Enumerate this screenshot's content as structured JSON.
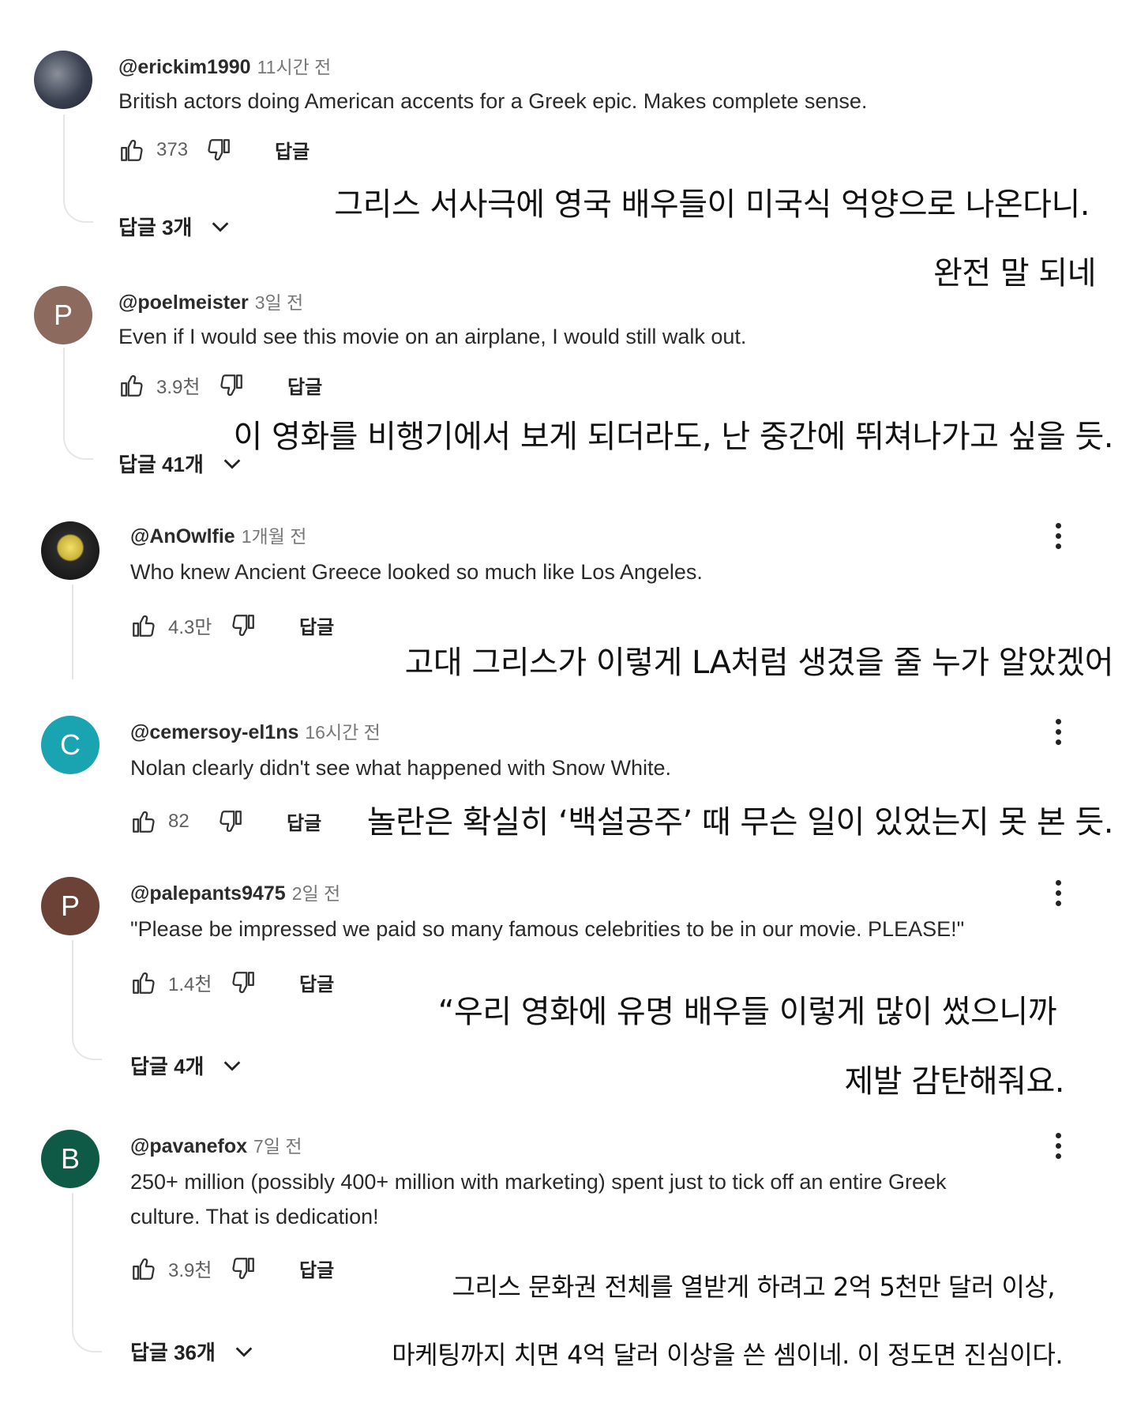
{
  "comments": [
    {
      "handle": "@erickim1990",
      "time": "11시간 전",
      "text": "British actors doing American accents for a Greek epic. Makes complete sense.",
      "likes": "373",
      "reply_label": "답글",
      "replies_label": "답글 3개",
      "translation": [
        "그리스 서사극에 영국 배우들이 미국식 억양으로 나온다니.",
        "완전 말 되네"
      ]
    },
    {
      "handle": "@poelmeister",
      "time": "3일 전",
      "avatar_letter": "P",
      "text": "Even if I would see this movie on an airplane, I would still walk out.",
      "likes": "3.9천",
      "reply_label": "답글",
      "replies_label": "답글 41개",
      "translation": [
        "이 영화를 비행기에서 보게 되더라도, 난 중간에 뛰쳐나가고 싶을 듯."
      ]
    },
    {
      "handle": "@AnOwlfie",
      "time": "1개월 전",
      "text": "Who knew Ancient Greece looked so much like Los Angeles.",
      "likes": "4.3만",
      "reply_label": "답글",
      "translation": [
        "고대 그리스가 이렇게 LA처럼 생겼을 줄 누가 알았겠어"
      ]
    },
    {
      "handle": "@cemersoy-el1ns",
      "time": "16시간 전",
      "avatar_letter": "C",
      "text": "Nolan clearly didn't see what happened with Snow White.",
      "likes": "82",
      "reply_label": "답글",
      "translation": [
        "놀란은 확실히 ‘백설공주’ 때 무슨 일이 있었는지 못 본 듯."
      ]
    },
    {
      "handle": "@palepants9475",
      "time": "2일 전",
      "avatar_letter": "P",
      "text": "\"Please be impressed we paid so many famous celebrities to be in our movie. PLEASE!\"",
      "likes": "1.4천",
      "reply_label": "답글",
      "replies_label": "답글 4개",
      "translation": [
        "“우리 영화에 유명 배우들 이렇게 많이 썼으니까",
        "제발 감탄해줘요."
      ]
    },
    {
      "handle": "@pavanefox",
      "time": "7일 전",
      "avatar_letter": "B",
      "text_line1": "250+ million (possibly 400+ million with marketing) spent just to tick off an entire Greek",
      "text_line2": "culture. That is dedication!",
      "likes": "3.9천",
      "reply_label": "답글",
      "replies_label": "답글 36개",
      "translation": [
        "그리스 문화권 전체를 열받게 하려고 2억 5천만 달러 이상,",
        "마케팅까지 치면 4억 달러 이상을 쓴 셈이네. 이 정도면 진심이다."
      ]
    }
  ],
  "colors": {
    "avatar_p1": "#8d6a5e",
    "avatar_c": "#1aa3b1",
    "avatar_p2": "#6d4236",
    "avatar_b": "#0f5a47"
  },
  "icons": [
    "like-icon",
    "dislike-icon",
    "chevron-down-icon",
    "more-vert-icon"
  ]
}
